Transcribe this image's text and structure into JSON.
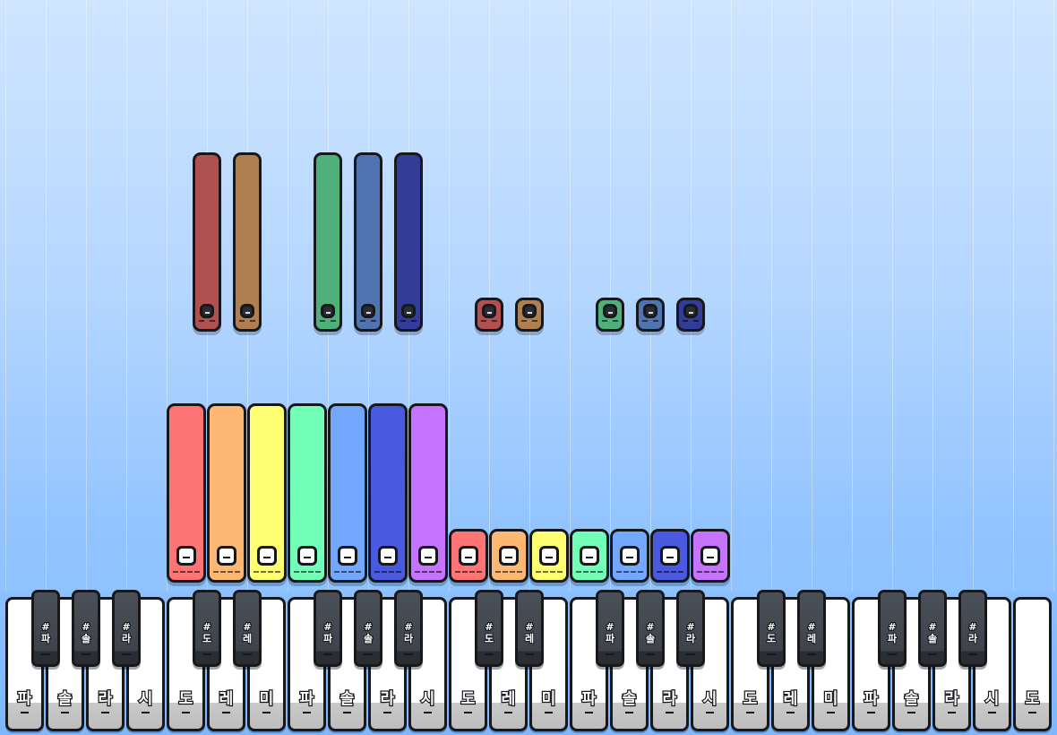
{
  "scale": {
    "white_labels": [
      "파",
      "솔",
      "라",
      "시",
      "도",
      "레",
      "미",
      "파",
      "솔",
      "라",
      "시",
      "도",
      "레",
      "미",
      "파",
      "솔",
      "라",
      "시",
      "도",
      "레",
      "미",
      "파",
      "솔",
      "라",
      "시",
      "도"
    ],
    "black_keys": [
      {
        "after_white": 0,
        "label": "#\n파"
      },
      {
        "after_white": 1,
        "label": "#\n솔"
      },
      {
        "after_white": 2,
        "label": "#\n라"
      },
      {
        "after_white": 4,
        "label": "#\n도"
      },
      {
        "after_white": 5,
        "label": "#\n레"
      },
      {
        "after_white": 7,
        "label": "#\n파"
      },
      {
        "after_white": 8,
        "label": "#\n솔"
      },
      {
        "after_white": 9,
        "label": "#\n라"
      },
      {
        "after_white": 11,
        "label": "#\n도"
      },
      {
        "after_white": 12,
        "label": "#\n레"
      },
      {
        "after_white": 14,
        "label": "#\n파"
      },
      {
        "after_white": 15,
        "label": "#\n솔"
      },
      {
        "after_white": 16,
        "label": "#\n라"
      },
      {
        "after_white": 18,
        "label": "#\n도"
      },
      {
        "after_white": 19,
        "label": "#\n레"
      },
      {
        "after_white": 21,
        "label": "#\n파"
      },
      {
        "after_white": 22,
        "label": "#\n솔"
      },
      {
        "after_white": 23,
        "label": "#\n라"
      }
    ]
  },
  "falling_notes": {
    "white": [
      {
        "key": 4,
        "color": "#ff7474",
        "length": 5
      },
      {
        "key": 5,
        "color": "#ffb874",
        "length": 5
      },
      {
        "key": 6,
        "color": "#ffff74",
        "length": 5
      },
      {
        "key": 7,
        "color": "#74ffb8",
        "length": 5
      },
      {
        "key": 8,
        "color": "#74a8ff",
        "length": 5
      },
      {
        "key": 9,
        "color": "#4a5ae0",
        "length": 5
      },
      {
        "key": 10,
        "color": "#c674ff",
        "length": 5
      },
      {
        "key": 11,
        "color": "#ff7474",
        "length": 1
      },
      {
        "key": 12,
        "color": "#ffb874",
        "length": 1
      },
      {
        "key": 13,
        "color": "#ffff74",
        "length": 1
      },
      {
        "key": 14,
        "color": "#74ffb8",
        "length": 1
      },
      {
        "key": 15,
        "color": "#74a8ff",
        "length": 1
      },
      {
        "key": 16,
        "color": "#4a5ae0",
        "length": 1
      },
      {
        "key": 17,
        "color": "#c674ff",
        "length": 1
      }
    ],
    "black": [
      {
        "key": 3,
        "color": "#b05050",
        "length": 6
      },
      {
        "key": 4,
        "color": "#b07f50",
        "length": 6
      },
      {
        "key": 5,
        "color": "#50b07a",
        "length": 6
      },
      {
        "key": 6,
        "color": "#5074b0",
        "length": 6
      },
      {
        "key": 7,
        "color": "#343c9a",
        "length": 6
      },
      {
        "key": 8,
        "color": "#b05050",
        "length": 1
      },
      {
        "key": 9,
        "color": "#b07f50",
        "length": 1
      },
      {
        "key": 10,
        "color": "#50b07a",
        "length": 1
      },
      {
        "key": 11,
        "color": "#5074b0",
        "length": 1
      },
      {
        "key": 12,
        "color": "#343c9a",
        "length": 1
      }
    ]
  }
}
